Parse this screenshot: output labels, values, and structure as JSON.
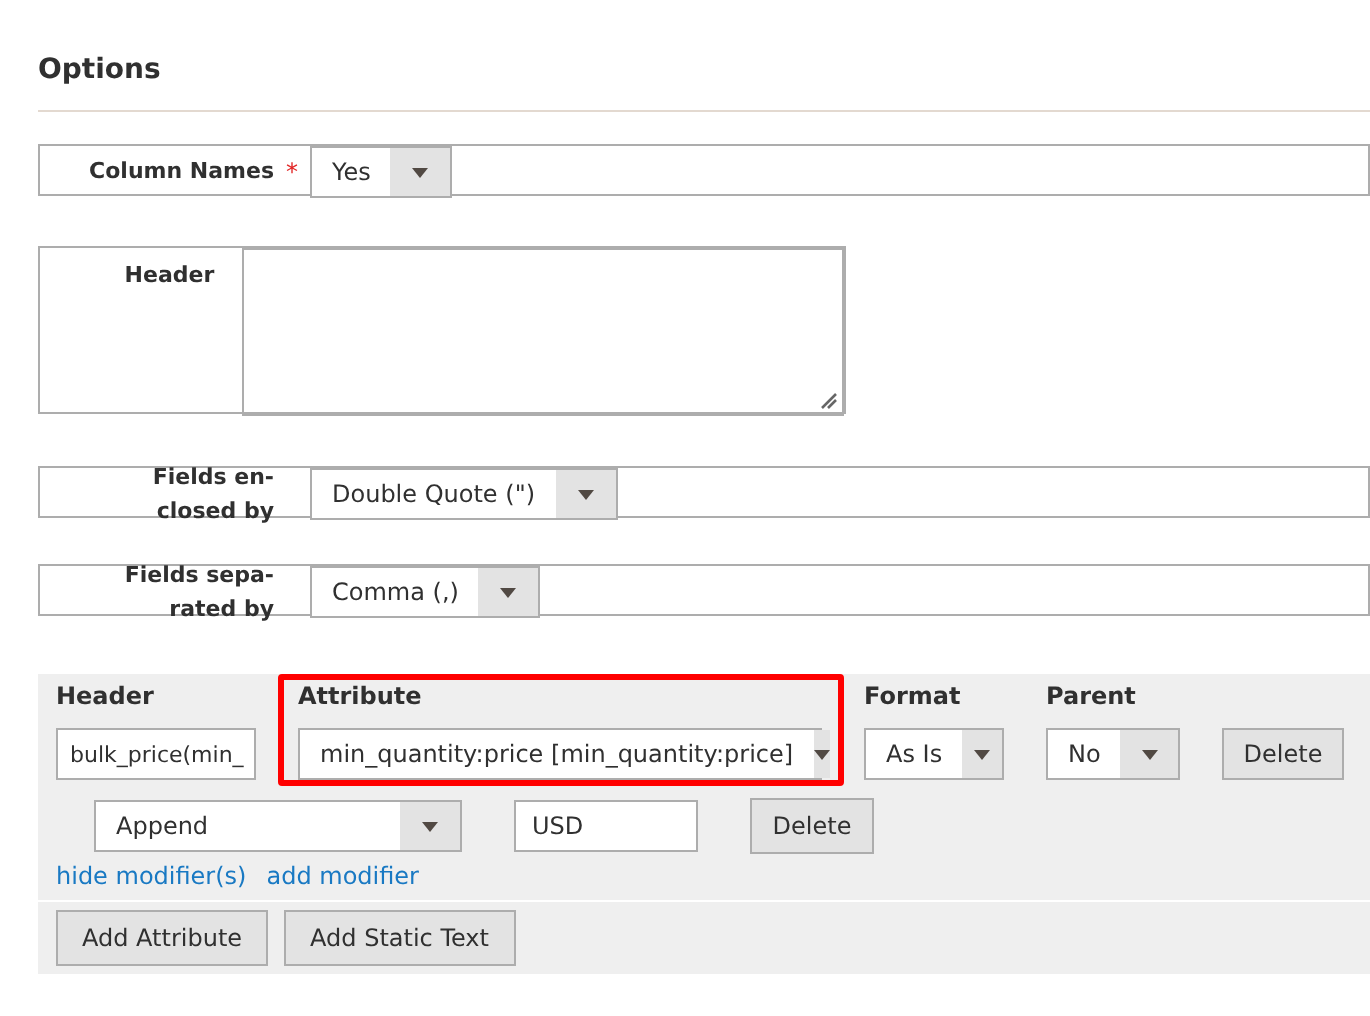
{
  "section": {
    "title": "Options"
  },
  "fields": [
    {
      "kind": "select",
      "label": "Column Names",
      "required_mark": "*",
      "value": "Yes"
    },
    {
      "kind": "textarea",
      "label": "Header"
    },
    {
      "kind": "select",
      "label": "Fields en-\nclosed by",
      "value": "Double Quote (\")"
    },
    {
      "kind": "select",
      "label": "Fields sepa-\nrated by",
      "value": "Comma (,)"
    }
  ],
  "mapping": {
    "columns": [
      {
        "label": "Header",
        "highlighted": false
      },
      {
        "label": "Attribute",
        "highlighted": true
      },
      {
        "label": "Format",
        "highlighted": false
      },
      {
        "label": "Parent",
        "highlighted": false
      }
    ],
    "row": {
      "header": "bulk_price(min_",
      "attribute": "min_quantity:price [min_quantity:price]",
      "format": "As Is",
      "parent": "No",
      "delete": "Delete"
    },
    "modifier": {
      "type": "Append",
      "value": "USD",
      "delete": "Delete"
    },
    "links": [
      "hide modifier(s)",
      "add modifier"
    ],
    "buttons": [
      "Add Attribute",
      "Add Static Text"
    ]
  }
}
